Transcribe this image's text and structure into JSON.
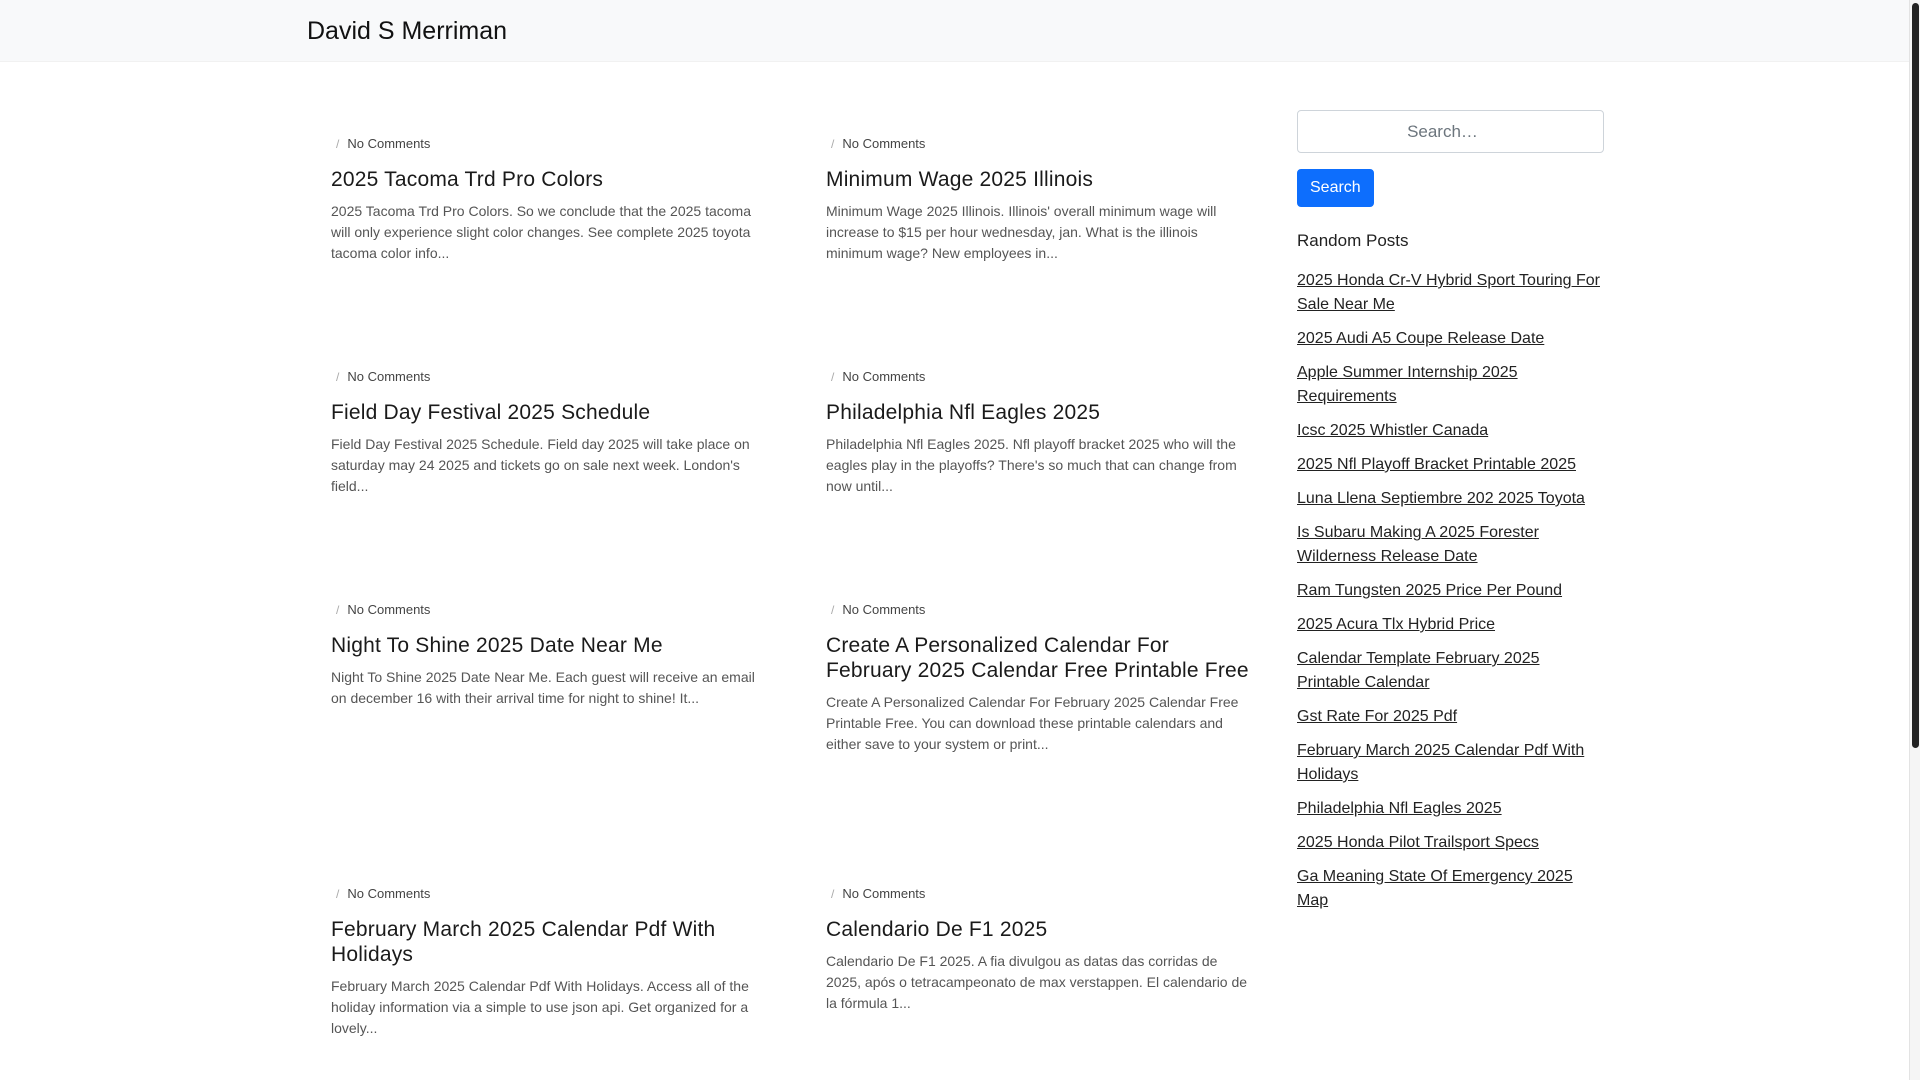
{
  "header": {
    "brand": "David S Merriman"
  },
  "posts": [
    {
      "comments": "No Comments",
      "title": "2025 Tacoma Trd Pro Colors",
      "excerpt": "2025 Tacoma Trd Pro Colors. So we conclude that the 2025 tacoma will only experience slight color changes. See complete 2025 toyota tacoma color info..."
    },
    {
      "comments": "No Comments",
      "title": "Minimum Wage 2025 Illinois",
      "excerpt": "Minimum Wage 2025 Illinois. Illinois' overall minimum wage will increase to $15 per hour wednesday, jan. What is the illinois minimum wage? New employees in..."
    },
    {
      "comments": "No Comments",
      "title": "Field Day Festival 2025 Schedule",
      "excerpt": "Field Day Festival 2025 Schedule. Field day 2025 will take place on saturday may 24 2025 and tickets go on sale next week. London's field..."
    },
    {
      "comments": "No Comments",
      "title": "Philadelphia Nfl Eagles 2025",
      "excerpt": "Philadelphia Nfl Eagles 2025. Nfl playoff bracket 2025 who will the eagles play in the playoffs? There's so much that can change from now until..."
    },
    {
      "comments": "No Comments",
      "title": "Night To Shine 2025 Date Near Me",
      "excerpt": "Night To Shine 2025 Date Near Me. Each guest will receive an email on december 16 with their arrival time for night to shine! It..."
    },
    {
      "comments": "No Comments",
      "title": "Create A Personalized Calendar For February 2025 Calendar Free Printable Free",
      "excerpt": "Create A Personalized Calendar For February 2025 Calendar Free Printable Free. You can download these printable calendars and either save to your system or print..."
    },
    {
      "comments": "No Comments",
      "title": "February March 2025 Calendar Pdf With Holidays",
      "excerpt": "February March 2025 Calendar Pdf With Holidays. Access all of the holiday information via a simple to use json api. Get organized for a lovely..."
    },
    {
      "comments": "No Comments",
      "title": "Calendario De F1 2025",
      "excerpt": "Calendario De F1 2025. A fia divulgou as datas das corridas de 2025, após o tetracampeonato de max verstappen. El calendario de la fórmula 1..."
    }
  ],
  "sidebar": {
    "search_placeholder": "Search…",
    "search_button": "Search",
    "random_heading": "Random Posts",
    "random_posts": [
      "2025 Honda Cr-V Hybrid Sport Touring For Sale Near Me",
      "2025 Audi A5 Coupe Release Date",
      "Apple Summer Internship 2025 Requirements",
      "Icsc 2025 Whistler Canada",
      "2025 Nfl Playoff Bracket Printable 2025",
      "Luna Llena Septiembre 202 2025 Toyota",
      "Is Subaru Making A 2025 Forester Wilderness Release Date",
      "Ram Tungsten 2025 Price Per Pound",
      "2025 Acura Tlx Hybrid Price",
      "Calendar Template February 2025 Printable Calendar",
      "Gst Rate For 2025 Pdf",
      "February March 2025 Calendar Pdf With Holidays",
      "Philadelphia Nfl Eagles 2025",
      "2025 Honda Pilot Trailsport Specs",
      "Ga Meaning State Of Emergency 2025 Map"
    ]
  }
}
